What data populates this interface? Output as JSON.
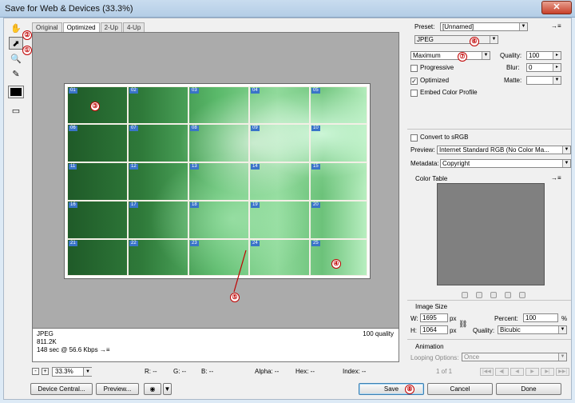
{
  "window": {
    "title": "Save for Web & Devices (33.3%)",
    "close_glyph": "✕"
  },
  "tabs": [
    "Original",
    "Optimized",
    "2-Up",
    "4-Up"
  ],
  "active_tab": "Optimized",
  "tools": [
    {
      "name": "hand-tool-icon",
      "glyph": "✋"
    },
    {
      "name": "slice-select-tool-icon",
      "glyph": "⬈"
    },
    {
      "name": "zoom-tool-icon",
      "glyph": "🔍"
    },
    {
      "name": "eyedropper-tool-icon",
      "glyph": "✎"
    }
  ],
  "markers": [
    "①",
    "②",
    "③",
    "④",
    "⑤",
    "⑥",
    "⑦",
    "⑧"
  ],
  "slices": [
    "01",
    "02",
    "03",
    "04",
    "05",
    "06",
    "07",
    "08",
    "09",
    "10",
    "11",
    "12",
    "13",
    "14",
    "15",
    "16",
    "17",
    "18",
    "19",
    "20",
    "21",
    "22",
    "23",
    "24",
    "25"
  ],
  "info": {
    "format": "JPEG",
    "size": "811.2K",
    "speed": "148 sec @ 56.6 Kbps",
    "speed_icon": "→≡",
    "quality": "100 quality"
  },
  "status": {
    "zoom": "33.3%",
    "r": "R: --",
    "g": "G: --",
    "b": "B: --",
    "alpha": "Alpha: --",
    "hex": "Hex: --",
    "index": "Index: --"
  },
  "buttons": {
    "device_central": "Device Central...",
    "preview": "Preview...",
    "save": "Save",
    "cancel": "Cancel",
    "done": "Done",
    "zoom_out": "-",
    "zoom_in": "+"
  },
  "panel": {
    "preset_label": "Preset:",
    "preset_value": "[Unnamed]",
    "format_value": "JPEG",
    "compression_value": "Maximum",
    "quality_label": "Quality:",
    "quality_value": "100",
    "blur_label": "Blur:",
    "blur_value": "0",
    "matte_label": "Matte:",
    "progressive_label": "Progressive",
    "progressive_checked": false,
    "optimized_label": "Optimized",
    "optimized_checked": true,
    "embed_label": "Embed Color Profile",
    "embed_checked": false,
    "convert_label": "Convert to sRGB",
    "convert_checked": false,
    "preview_label": "Preview:",
    "preview_value": "Internet Standard RGB (No Color Ma...",
    "metadata_label": "Metadata:",
    "metadata_value": "Copyright",
    "color_table_label": "Color Table",
    "image_size_label": "Image Size",
    "w_label": "W:",
    "w_value": "1695",
    "h_label": "H:",
    "h_value": "1064",
    "px": "px",
    "percent_label": "Percent:",
    "percent_value": "100",
    "percent_unit": "%",
    "quality2_label": "Quality:",
    "quality2_value": "Bicubic",
    "animation_label": "Animation",
    "looping_label": "Looping Options:",
    "looping_value": "Once",
    "frame_counter": "1 of 1",
    "anim_controls": [
      "|◀◀",
      "◀|",
      "◀",
      "▶",
      "▶|",
      "▶▶|"
    ]
  }
}
